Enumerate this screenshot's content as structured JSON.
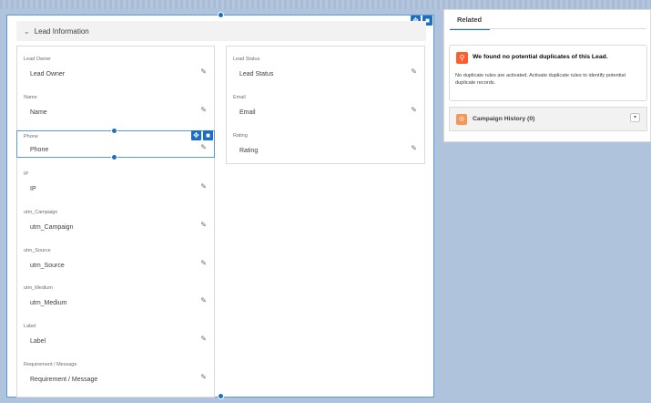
{
  "lead_info": {
    "header": "Lead Information",
    "left_fields": [
      {
        "label": "Lead Owner",
        "value": "Lead Owner"
      },
      {
        "label": "Name",
        "value": "Name"
      },
      {
        "label": "Phone",
        "value": "Phone"
      },
      {
        "label": "IP",
        "value": "IP"
      },
      {
        "label": "utm_Campaign",
        "value": "utm_Campaign"
      },
      {
        "label": "utm_Source",
        "value": "utm_Source"
      },
      {
        "label": "utm_Medium",
        "value": "utm_Medium"
      },
      {
        "label": "Label",
        "value": "Label"
      },
      {
        "label": "Requirement / Message",
        "value": "Requirement / Message"
      }
    ],
    "right_fields": [
      {
        "label": "Lead Status",
        "value": "Lead Status"
      },
      {
        "label": "Email",
        "value": "Email"
      },
      {
        "label": "Rating",
        "value": "Rating"
      }
    ]
  },
  "related": {
    "tab": "Related",
    "duplicates_title": "We found no potential duplicates of this Lead.",
    "duplicates_body": "No duplicate rules are activated. Activate duplicate rules to identify potential duplicate records.",
    "campaign_history": "Campaign History (0)"
  },
  "icons": {
    "move": "move-icon",
    "delete": "trash-icon",
    "edit": "pencil-icon",
    "chevron": "chevron-down-icon",
    "duplicates": "duplicate-person-icon",
    "campaign": "campaign-target-icon"
  },
  "colors": {
    "selection": "#5b9bd5",
    "handle": "#1b6fc2",
    "duplicate_icon": "#ff5d2d",
    "campaign_icon": "#f49756"
  }
}
